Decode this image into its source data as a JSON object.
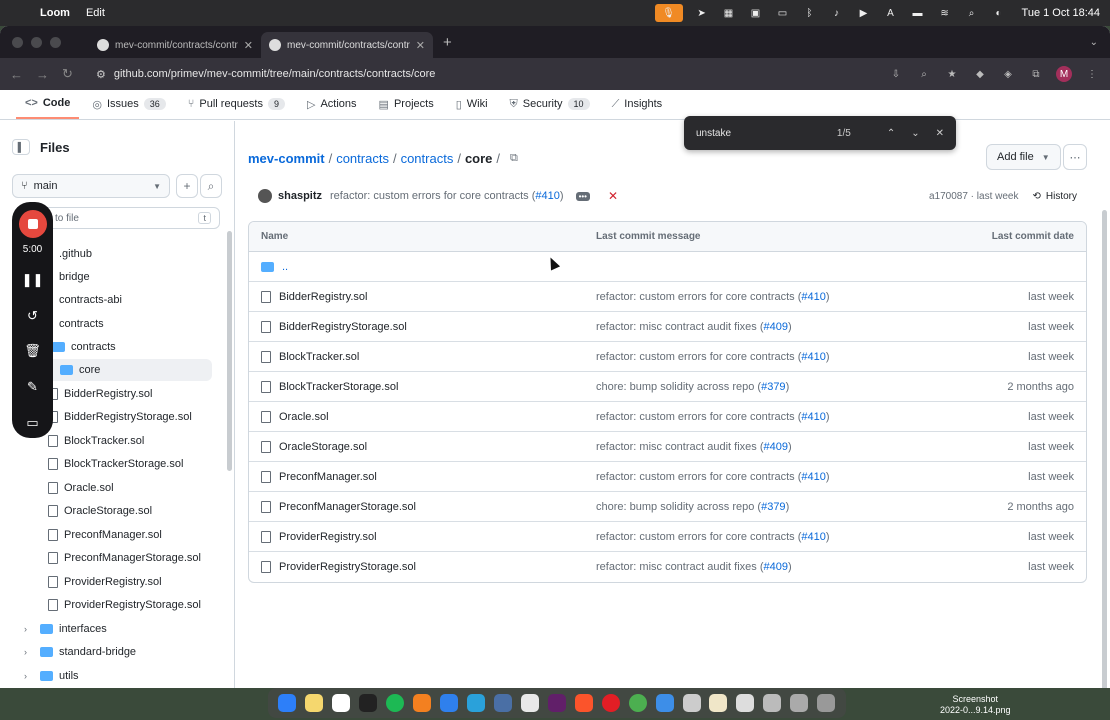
{
  "menubar": {
    "app": "Loom",
    "menu_edit": "Edit",
    "clock": "Tue 1 Oct  18:44"
  },
  "browser": {
    "tabs": [
      {
        "title": "mev-commit/contracts/contr"
      },
      {
        "title": "mev-commit/contracts/contr"
      }
    ],
    "url": "github.com/primev/mev-commit/tree/main/contracts/contracts/core"
  },
  "repo_nav": {
    "items": [
      {
        "label": "Code"
      },
      {
        "label": "Issues",
        "count": "36"
      },
      {
        "label": "Pull requests",
        "count": "9"
      },
      {
        "label": "Actions"
      },
      {
        "label": "Projects"
      },
      {
        "label": "Wiki"
      },
      {
        "label": "Security",
        "count": "10"
      },
      {
        "label": "Insights"
      }
    ]
  },
  "find": {
    "query": "unstake",
    "count": "1/5"
  },
  "sidebar": {
    "title": "Files",
    "branch": "main",
    "goto_placeholder": "to file",
    "goto_kbd": "t",
    "tree": [
      {
        "label": ".github",
        "type": "folder"
      },
      {
        "label": "bridge",
        "type": "folder"
      },
      {
        "label": "contracts-abi",
        "type": "folder"
      },
      {
        "label": "contracts",
        "type": "folder"
      },
      {
        "label": "contracts",
        "type": "folder"
      },
      {
        "label": "core",
        "type": "folder"
      },
      {
        "label": "BidderRegistry.sol",
        "type": "file"
      },
      {
        "label": "BidderRegistryStorage.sol",
        "type": "file"
      },
      {
        "label": "BlockTracker.sol",
        "type": "file"
      },
      {
        "label": "BlockTrackerStorage.sol",
        "type": "file"
      },
      {
        "label": "Oracle.sol",
        "type": "file"
      },
      {
        "label": "OracleStorage.sol",
        "type": "file"
      },
      {
        "label": "PreconfManager.sol",
        "type": "file"
      },
      {
        "label": "PreconfManagerStorage.sol",
        "type": "file"
      },
      {
        "label": "ProviderRegistry.sol",
        "type": "file"
      },
      {
        "label": "ProviderRegistryStorage.sol",
        "type": "file"
      },
      {
        "label": "interfaces",
        "type": "folder"
      },
      {
        "label": "standard-bridge",
        "type": "folder"
      },
      {
        "label": "utils",
        "type": "folder"
      }
    ]
  },
  "loom": {
    "timer": "5:00"
  },
  "breadcrumb": {
    "repo": "mev-commit",
    "p1": "contracts",
    "p2": "contracts",
    "current": "core",
    "sep": "/"
  },
  "actions": {
    "add_file": "Add file"
  },
  "commit": {
    "author": "shaspitz",
    "message": "refactor: custom errors for core contracts (",
    "pr": "#410",
    "close": ")",
    "sha_time": "a170087 · last week",
    "history": "History"
  },
  "table": {
    "headers": {
      "name": "Name",
      "msg": "Last commit message",
      "date": "Last commit date"
    },
    "parent": "..",
    "rows": [
      {
        "name": "BidderRegistry.sol",
        "msg": "refactor: custom errors for core contracts (",
        "pr": "#410",
        "date": "last week"
      },
      {
        "name": "BidderRegistryStorage.sol",
        "msg": "refactor: misc contract audit fixes (",
        "pr": "#409",
        "date": "last week"
      },
      {
        "name": "BlockTracker.sol",
        "msg": "refactor: custom errors for core contracts (",
        "pr": "#410",
        "date": "last week"
      },
      {
        "name": "BlockTrackerStorage.sol",
        "msg": "chore: bump solidity across repo (",
        "pr": "#379",
        "date": "2 months ago"
      },
      {
        "name": "Oracle.sol",
        "msg": "refactor: custom errors for core contracts (",
        "pr": "#410",
        "date": "last week"
      },
      {
        "name": "OracleStorage.sol",
        "msg": "refactor: misc contract audit fixes (",
        "pr": "#409",
        "date": "last week"
      },
      {
        "name": "PreconfManager.sol",
        "msg": "refactor: custom errors for core contracts (",
        "pr": "#410",
        "date": "last week"
      },
      {
        "name": "PreconfManagerStorage.sol",
        "msg": "chore: bump solidity across repo (",
        "pr": "#379",
        "date": "2 months ago"
      },
      {
        "name": "ProviderRegistry.sol",
        "msg": "refactor: custom errors for core contracts (",
        "pr": "#410",
        "date": "last week"
      },
      {
        "name": "ProviderRegistryStorage.sol",
        "msg": "refactor: misc contract audit fixes (",
        "pr": "#409",
        "date": "last week"
      }
    ]
  },
  "desktop": {
    "file_label_1": "Screenshot",
    "file_label_2": "2022-0...9.14.png"
  }
}
